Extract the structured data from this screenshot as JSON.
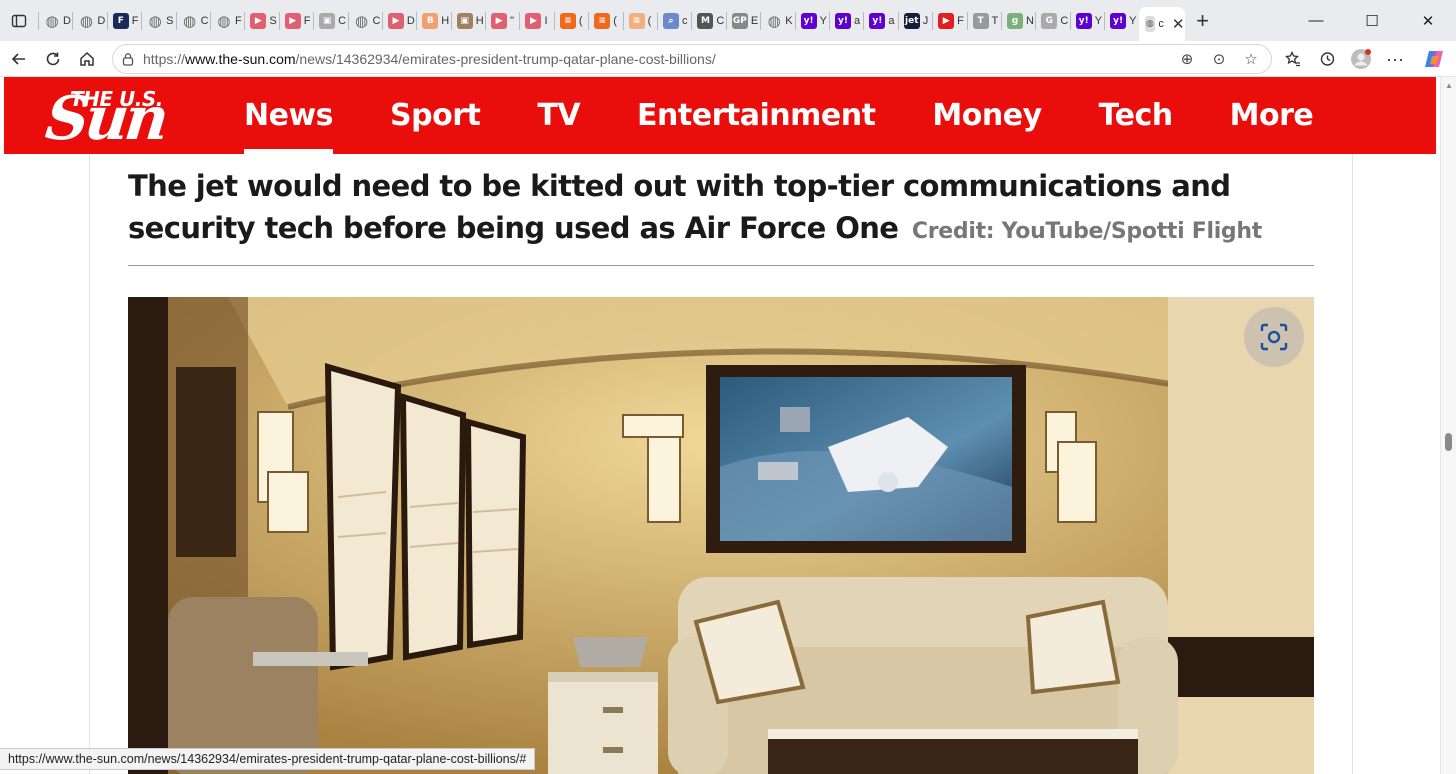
{
  "browser": {
    "tabs": [
      {
        "icon": "globe-icon",
        "letter": "D",
        "color": "#777"
      },
      {
        "icon": "globe-icon",
        "letter": "D",
        "color": "#777"
      },
      {
        "icon": "foxnews-icon",
        "letter": "F",
        "color": "#1a2a5a"
      },
      {
        "icon": "globe-icon",
        "letter": "S",
        "color": "#777"
      },
      {
        "icon": "globe-icon",
        "letter": "C",
        "color": "#777"
      },
      {
        "icon": "globe-icon",
        "letter": "F",
        "color": "#777"
      },
      {
        "icon": "youtube-icon",
        "letter": "S",
        "color": "#e06070"
      },
      {
        "icon": "youtube-icon",
        "letter": "F",
        "color": "#e06070"
      },
      {
        "icon": "image-icon",
        "letter": "C",
        "color": "#aaa"
      },
      {
        "icon": "globe-icon",
        "letter": "C",
        "color": "#777"
      },
      {
        "icon": "youtube-icon",
        "letter": "D",
        "color": "#e06070"
      },
      {
        "icon": "blogger-icon",
        "letter": "H",
        "color": "#f0a070"
      },
      {
        "icon": "image-icon",
        "letter": "H",
        "color": "#a08060"
      },
      {
        "icon": "youtube-icon",
        "letter": "\"",
        "color": "#e06070"
      },
      {
        "icon": "youtube-icon",
        "letter": "I",
        "color": "#e06070"
      },
      {
        "icon": "substack-icon",
        "letter": "(",
        "color": "#f06a1c"
      },
      {
        "icon": "substack-icon",
        "letter": "(",
        "color": "#f06a1c"
      },
      {
        "icon": "substack-icon",
        "letter": "(",
        "color": "#f0b080"
      },
      {
        "icon": "search-icon",
        "letter": "c",
        "color": "#6a8acb"
      },
      {
        "icon": "mm-icon",
        "letter": "C",
        "color": "#555"
      },
      {
        "icon": "gp-icon",
        "letter": "E",
        "color": "#888"
      },
      {
        "icon": "globe-icon",
        "letter": "K",
        "color": "#777"
      },
      {
        "icon": "yahoo-icon",
        "letter": "Y",
        "color": "#5f01d1"
      },
      {
        "icon": "yahoo-icon",
        "letter": "a",
        "color": "#5f01d1"
      },
      {
        "icon": "yahoo-icon",
        "letter": "a",
        "color": "#5f01d1"
      },
      {
        "icon": "jet-icon",
        "letter": "J",
        "color": "#1a1a3a"
      },
      {
        "icon": "youtube-icon",
        "letter": "F",
        "color": "#e02020"
      },
      {
        "icon": "tnc-icon",
        "letter": "T",
        "color": "#999"
      },
      {
        "icon": "gg-icon",
        "letter": "N",
        "color": "#7ab07a"
      },
      {
        "icon": "google-icon",
        "letter": "C",
        "color": "#aaa"
      },
      {
        "icon": "yahoo-icon",
        "letter": "Y",
        "color": "#5f01d1"
      },
      {
        "icon": "yahoo-icon",
        "letter": "Y",
        "color": "#5f01d1"
      }
    ],
    "active_tab_letter": "c",
    "address": {
      "scheme": "https://",
      "host": "www.the-sun.com",
      "path": "/news/14362934/emirates-president-trump-qatar-plane-cost-billions/"
    },
    "status_url": "https://www.the-sun.com/news/14362934/emirates-president-trump-qatar-plane-cost-billions/#"
  },
  "site": {
    "logo_top": "THE U.S.",
    "logo_main": "Sun",
    "nav": [
      "News",
      "Sport",
      "TV",
      "Entertainment",
      "Money",
      "Tech",
      "More"
    ],
    "active_nav": "News",
    "brand_color": "#e90e0c"
  },
  "article": {
    "caption": "The jet would need to be kitted out with top-tier communications and security tech before being used as Air Force One",
    "credit": "Credit: YouTube/Spotti Flight"
  }
}
